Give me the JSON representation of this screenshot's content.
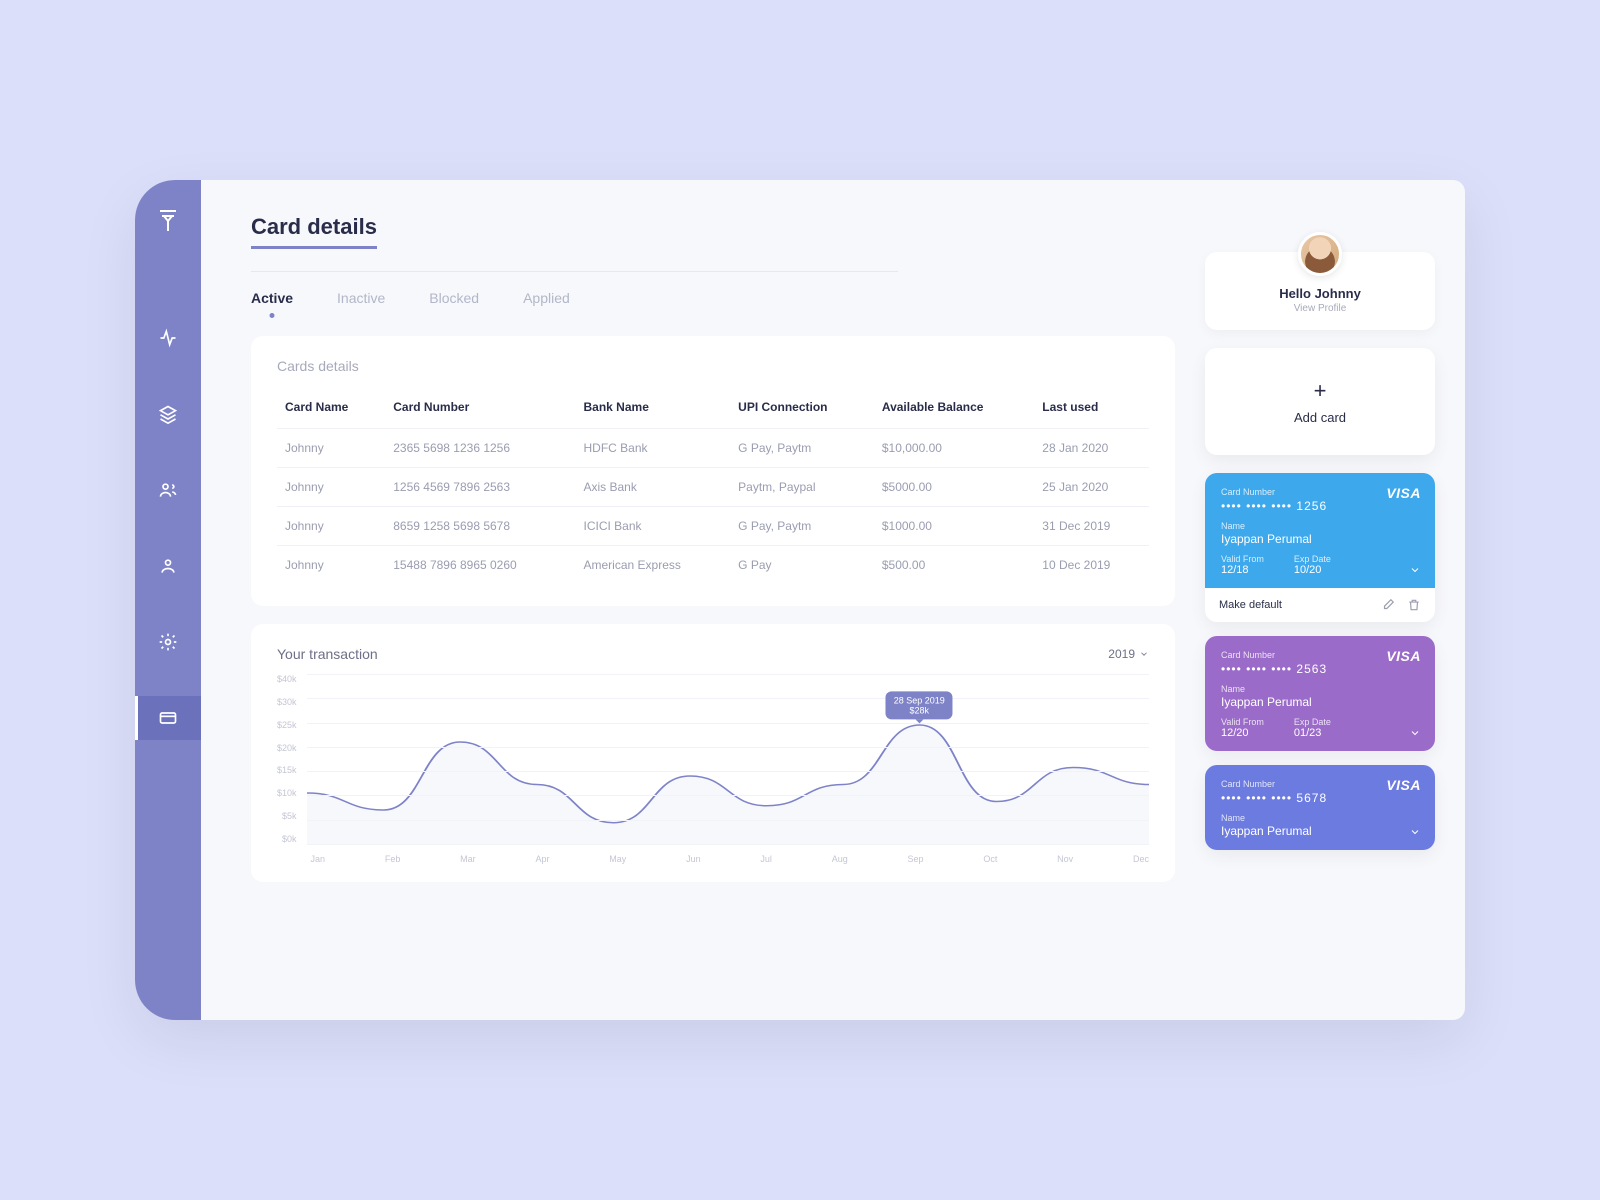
{
  "page_title": "Card details",
  "tabs": [
    "Active",
    "Inactive",
    "Blocked",
    "Applied"
  ],
  "active_tab": 0,
  "table": {
    "title": "Cards details",
    "columns": [
      "Card Name",
      "Card Number",
      "Bank Name",
      "UPI Connection",
      "Available Balance",
      "Last used"
    ],
    "rows": [
      [
        "Johnny",
        "2365 5698 1236 1256",
        "HDFC Bank",
        "G Pay, Paytm",
        "$10,000.00",
        "28 Jan 2020"
      ],
      [
        "Johnny",
        "1256 4569 7896 2563",
        "Axis Bank",
        "Paytm, Paypal",
        "$5000.00",
        "25 Jan 2020"
      ],
      [
        "Johnny",
        "8659 1258 5698 5678",
        "ICICI Bank",
        "G Pay, Paytm",
        "$1000.00",
        "31 Dec 2019"
      ],
      [
        "Johnny",
        "15488 7896 8965 0260",
        "American Express",
        "G Pay",
        "$500.00",
        "10 Dec 2019"
      ]
    ]
  },
  "chart_title": "Your transaction",
  "chart_year": "2019",
  "chart_tooltip": {
    "date": "28 Sep 2019",
    "value": "$28k"
  },
  "chart_data": {
    "type": "line",
    "categories": [
      "Jan",
      "Feb",
      "Mar",
      "Apr",
      "May",
      "Jun",
      "Jul",
      "Aug",
      "Sep",
      "Oct",
      "Nov",
      "Dec"
    ],
    "values": [
      12,
      8,
      24,
      14,
      5,
      16,
      9,
      14,
      28,
      10,
      18,
      14
    ],
    "ylabel": "$k",
    "ylim": [
      0,
      40
    ],
    "y_ticks": [
      "$40k",
      "$30k",
      "$25k",
      "$20k",
      "$15k",
      "$10k",
      "$5k",
      "$0k"
    ],
    "tooltip_point": {
      "month": "Sep",
      "value": 28,
      "label_date": "28 Sep 2019",
      "label_value": "$28k"
    }
  },
  "profile": {
    "greeting": "Hello Johnny",
    "view_profile": "View Profile"
  },
  "add_card_label": "Add card",
  "cards": [
    {
      "color": "#3da8ec",
      "brand": "VISA",
      "last4": "1256",
      "name": "Iyappan Perumal",
      "valid_from": "12/18",
      "exp": "10/20",
      "make_default": "Make default"
    },
    {
      "color": "#9b6bc9",
      "brand": "VISA",
      "last4": "2563",
      "name": "Iyappan Perumal",
      "valid_from": "12/20",
      "exp": "01/23"
    },
    {
      "color": "#6b7be0",
      "brand": "VISA",
      "last4": "5678",
      "name": "Iyappan Perumal"
    }
  ],
  "labels": {
    "card_number": "Card Number",
    "name": "Name",
    "valid_from": "Valid From",
    "exp_date": "Exp Date"
  }
}
